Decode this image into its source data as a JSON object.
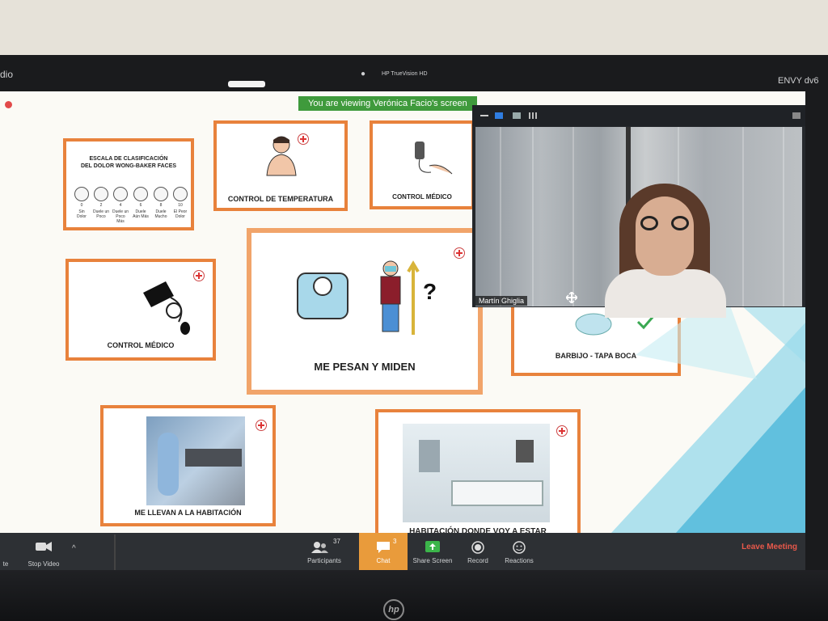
{
  "bezel": {
    "left_text": "dio",
    "camera_label": "HP TrueVision HD",
    "model": "ENVY dv6",
    "logo": "hp"
  },
  "zoom": {
    "viewing_banner": "You are viewing Verónica Facio's screen",
    "participant_name": "Martín Ghiglia",
    "participants_count": "37",
    "chat_count": "3",
    "toolbar": {
      "left_partial": "te",
      "stop_video": "Stop Video",
      "participants": "Participants",
      "chat": "Chat",
      "share_screen": "Share Screen",
      "record": "Record",
      "reactions": "Reactions",
      "leave": "Leave Meeting"
    }
  },
  "slide": {
    "wong_baker": {
      "title_line1": "ESCALA DE CLASIFICACIÓN",
      "title_line2": "DEL DOLOR WONG-BAKER FACES",
      "numbers": [
        "0",
        "2",
        "4",
        "6",
        "8",
        "10"
      ],
      "captions": [
        "Sin Dolor",
        "Duele un Poco",
        "Duele un Poco Más",
        "Duele Aún Más",
        "Duele Mucho",
        "El Peor Dolor"
      ]
    },
    "cards": {
      "temperature": "CONTROL DE TEMPERATURA",
      "medical_oximeter": "CONTROL MÉDICO",
      "medical_bp": "CONTROL MÉDICO",
      "weigh_measure": "ME PESAN Y MIDEN",
      "mask": "BARBIJO - TAPA BOCA",
      "taken_to_room": "ME LLEVAN A LA HABITACIÓN",
      "room": "HABITACIÓN DONDE VOY A ESTAR"
    }
  },
  "colors": {
    "card_border": "#e8823c",
    "zoom_green": "#3f9a3c",
    "chat_orange": "#e99b3b",
    "leave_red": "#e8584a"
  }
}
